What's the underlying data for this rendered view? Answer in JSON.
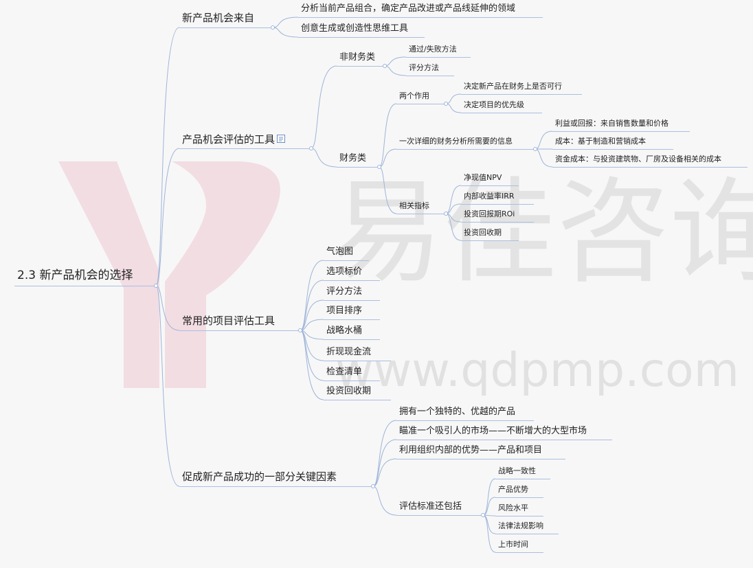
{
  "watermark": {
    "brand_cn": "易佳咨询",
    "url": "www.qdpmp.com",
    "colors": {
      "logo": "#f2dde3",
      "text": "#e2e2e2"
    }
  },
  "colors": {
    "line": "#9db4d8",
    "text": "#222222",
    "background": "#f7f7f7"
  },
  "mindmap": {
    "root": "2.3 新产品机会的选择",
    "branches": [
      {
        "label": "新产品机会来自",
        "children": [
          {
            "label": "分析当前产品组合，确定产品改进或产品线延伸的领域"
          },
          {
            "label": "创意生成或创造性思维工具"
          }
        ]
      },
      {
        "label": "产品机会评估的工具",
        "icon": "document-icon",
        "children": [
          {
            "label": "非财务类",
            "children": [
              {
                "label": "通过/失败方法"
              },
              {
                "label": "评分方法"
              }
            ]
          },
          {
            "label": "财务类",
            "children": [
              {
                "label": "两个作用",
                "children": [
                  {
                    "label": "决定新产品在财务上是否可行"
                  },
                  {
                    "label": "决定项目的优先级"
                  }
                ]
              },
              {
                "label": "一次详细的财务分析所需要的信息",
                "children": [
                  {
                    "label": "利益或回报：来自销售数量和价格"
                  },
                  {
                    "label": "成本：基于制造和营销成本"
                  },
                  {
                    "label": "资金成本：与投资建筑物、厂房及设备相关的成本"
                  }
                ]
              },
              {
                "label": "相关指标",
                "children": [
                  {
                    "label": "净现值NPV"
                  },
                  {
                    "label": "内部收益率IRR"
                  },
                  {
                    "label": "投资回报期ROi"
                  },
                  {
                    "label": "投资回收期"
                  }
                ]
              }
            ]
          }
        ]
      },
      {
        "label": "常用的项目评估工具",
        "children": [
          {
            "label": "气泡图"
          },
          {
            "label": "选项标价"
          },
          {
            "label": "评分方法"
          },
          {
            "label": "项目排序"
          },
          {
            "label": "战略水桶"
          },
          {
            "label": "折现现金流"
          },
          {
            "label": "检查清单"
          },
          {
            "label": "投资回收期"
          }
        ]
      },
      {
        "label": "促成新产品成功的一部分关键因素",
        "children": [
          {
            "label": "拥有一个独特的、优越的产品"
          },
          {
            "label": "瞄准一个吸引人的市场——不断增大的大型市场"
          },
          {
            "label": "利用组织内部的优势——产品和项目"
          },
          {
            "label": "评估标准还包括",
            "children": [
              {
                "label": "战略一致性"
              },
              {
                "label": "产品优势"
              },
              {
                "label": "风险水平"
              },
              {
                "label": "法律法规影响"
              },
              {
                "label": "上市时间"
              }
            ]
          }
        ]
      }
    ]
  }
}
